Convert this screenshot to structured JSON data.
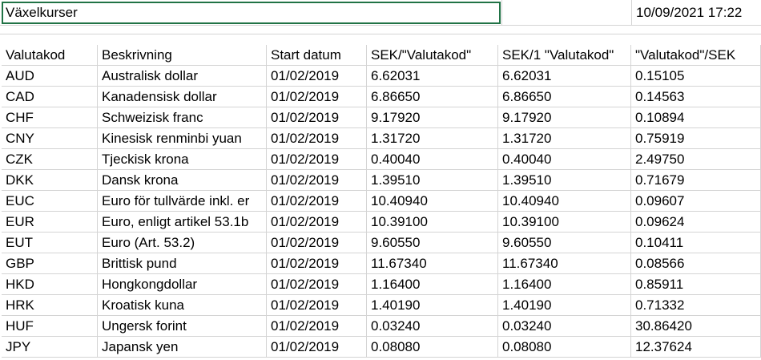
{
  "sheet": {
    "title": "Växelkurser",
    "timestamp": "10/09/2021 17:22"
  },
  "table": {
    "headers": [
      "Valutakod",
      "Beskrivning",
      "Start datum",
      "SEK/\"Valutakod\"",
      "SEK/1 \"Valutakod\"",
      "\"Valutakod\"/SEK"
    ],
    "rows": [
      [
        "AUD",
        "Australisk dollar",
        "01/02/2019",
        "6.62031",
        "6.62031",
        "0.15105"
      ],
      [
        "CAD",
        "Kanadensisk dollar",
        "01/02/2019",
        "6.86650",
        "6.86650",
        "0.14563"
      ],
      [
        "CHF",
        "Schweizisk franc",
        "01/02/2019",
        "9.17920",
        "9.17920",
        "0.10894"
      ],
      [
        "CNY",
        "Kinesisk renminbi yuan",
        "01/02/2019",
        "1.31720",
        "1.31720",
        "0.75919"
      ],
      [
        "CZK",
        "Tjeckisk krona",
        "01/02/2019",
        "0.40040",
        "0.40040",
        "2.49750"
      ],
      [
        "DKK",
        "Dansk krona",
        "01/02/2019",
        "1.39510",
        "1.39510",
        "0.71679"
      ],
      [
        "EUC",
        "Euro för tullvärde inkl. er",
        "01/02/2019",
        "10.40940",
        "10.40940",
        "0.09607"
      ],
      [
        "EUR",
        "Euro, enligt artikel 53.1b",
        "01/02/2019",
        "10.39100",
        "10.39100",
        "0.09624"
      ],
      [
        "EUT",
        "Euro (Art. 53.2)",
        "01/02/2019",
        "9.60550",
        "9.60550",
        "0.10411"
      ],
      [
        "GBP",
        "Brittisk pund",
        "01/02/2019",
        "11.67340",
        "11.67340",
        "0.08566"
      ],
      [
        "HKD",
        "Hongkongdollar",
        "01/02/2019",
        "1.16400",
        "1.16400",
        "0.85911"
      ],
      [
        "HRK",
        "Kroatisk kuna",
        "01/02/2019",
        "1.40190",
        "1.40190",
        "0.71332"
      ],
      [
        "HUF",
        "Ungersk forint",
        "01/02/2019",
        "0.03240",
        "0.03240",
        "30.86420"
      ],
      [
        "JPY",
        "Japansk yen",
        "01/02/2019",
        "0.08080",
        "0.08080",
        "12.37624"
      ]
    ]
  }
}
